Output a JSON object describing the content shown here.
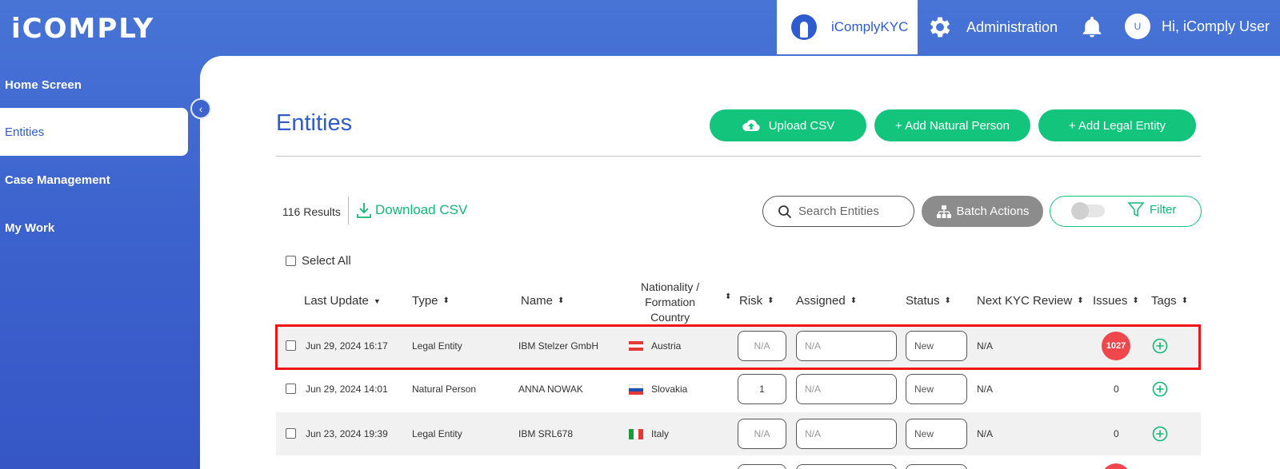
{
  "header": {
    "logo": "iCOMPLY",
    "kyc_tab": "iComplyKYC",
    "admin_label": "Administration",
    "avatar_initial": "U",
    "greeting": "Hi, iComply User"
  },
  "sidebar": {
    "items": [
      {
        "label": "Home Screen"
      },
      {
        "label": "Entities"
      },
      {
        "label": "Case Management"
      },
      {
        "label": "My Work"
      }
    ],
    "active_index": 1
  },
  "page": {
    "title": "Entities",
    "buttons": {
      "upload_csv": "Upload CSV",
      "add_natural_person": "+ Add Natural Person",
      "add_legal_entity": "+ Add Legal Entity"
    },
    "results_count": "116 Results",
    "download_csv": "Download CSV",
    "search_placeholder": "Search Entities",
    "batch_actions": "Batch Actions",
    "filter": "Filter",
    "select_all": "Select All"
  },
  "table": {
    "headers": {
      "last_update": "Last Update",
      "type": "Type",
      "name": "Name",
      "nationality_line1": "Nationality /",
      "nationality_line2": "Formation",
      "nationality_line3": "Country",
      "risk": "Risk",
      "assigned": "Assigned",
      "status": "Status",
      "next_kyc": "Next KYC Review",
      "issues": "Issues",
      "tags": "Tags"
    },
    "rows": [
      {
        "last_update": "Jun 29, 2024 16:17",
        "type": "Legal Entity",
        "name": "IBM Stelzer GmbH",
        "country": "Austria",
        "flag": "austria",
        "risk": "N/A",
        "assigned": "N/A",
        "status": "New",
        "next_kyc": "N/A",
        "issues": "1027",
        "highlighted": true
      },
      {
        "last_update": "Jun 29, 2024 14:01",
        "type": "Natural Person",
        "name": "ANNA NOWAK",
        "country": "Slovakia",
        "flag": "slovakia",
        "risk": "1",
        "assigned": "N/A",
        "status": "New",
        "next_kyc": "N/A",
        "issues": "0",
        "highlighted": false
      },
      {
        "last_update": "Jun 23, 2024 19:39",
        "type": "Legal Entity",
        "name": "IBM SRL678",
        "country": "Italy",
        "flag": "italy",
        "risk": "N/A",
        "assigned": "N/A",
        "status": "New",
        "next_kyc": "N/A",
        "issues": "0",
        "highlighted": false
      }
    ]
  },
  "colors": {
    "brand_blue": "#2f5bd0",
    "accent_green": "#13c47d",
    "badge_red": "#f0474d",
    "highlight_red": "#f01414"
  }
}
